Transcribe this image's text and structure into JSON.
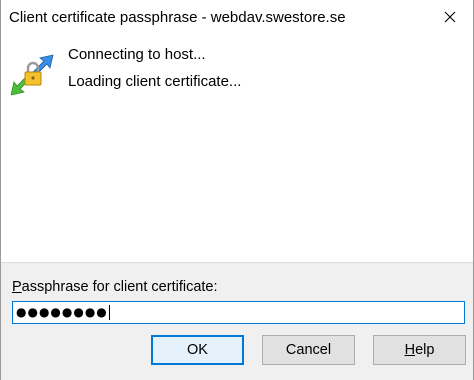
{
  "window": {
    "title": "Client certificate passphrase - webdav.swestore.se"
  },
  "status": {
    "icon": "secure-transfer-lock-icon",
    "lines": [
      "Connecting to host...",
      "Loading client certificate..."
    ]
  },
  "passphrase": {
    "label_first": "P",
    "label_rest": "assphrase for client certificate:",
    "value_masked": "●●●●●●●●"
  },
  "buttons": {
    "ok": "OK",
    "cancel": "Cancel",
    "help_first": "H",
    "help_rest": "elp"
  },
  "colors": {
    "accent": "#0078d7",
    "footer_bg": "#f0f0f0",
    "button_bg": "#e1e1e1"
  }
}
